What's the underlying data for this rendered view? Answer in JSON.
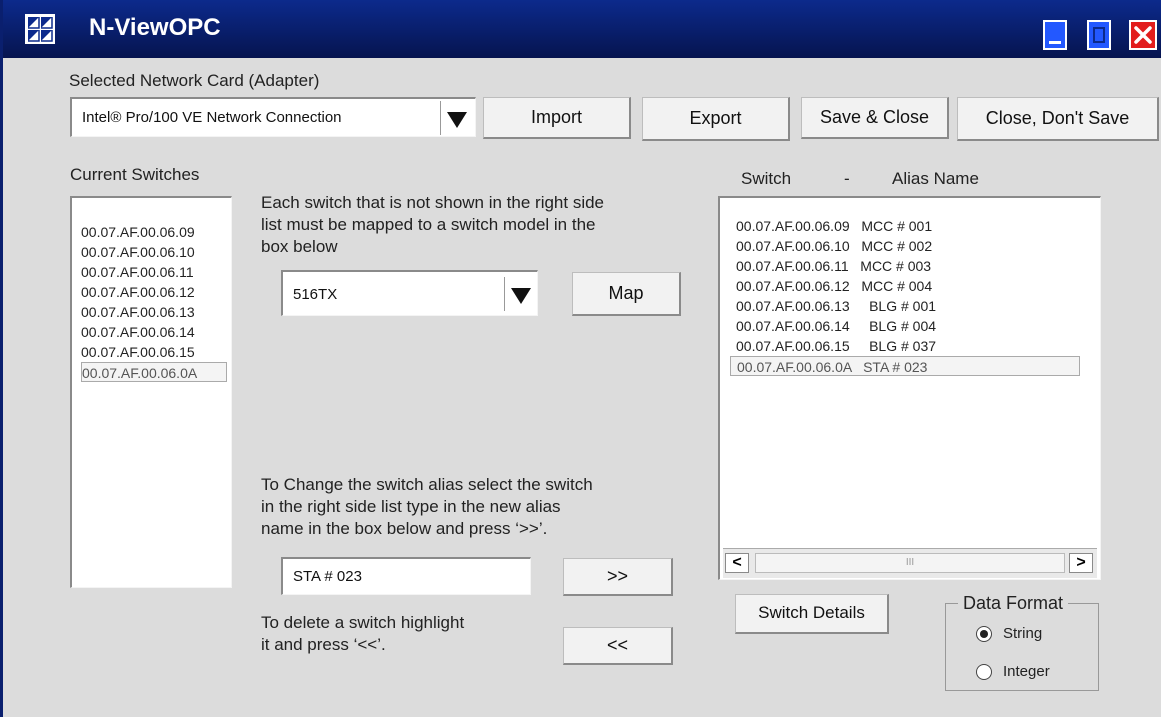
{
  "window": {
    "title": "N-ViewOPC"
  },
  "network": {
    "label": "Selected Network Card (Adapter)",
    "selected": "Intel® Pro/100 VE Network Connection"
  },
  "toolbar": {
    "import_label": "Import",
    "export_label": "Export",
    "save_close_label": "Save & Close",
    "close_nosave_label": "Close, Don't Save"
  },
  "current_switches": {
    "label": "Current Switches",
    "items": [
      "00.07.AF.00.06.09",
      "00.07.AF.00.06.10",
      "00.07.AF.00.06.11",
      "00.07.AF.00.06.12",
      "00.07.AF.00.06.13",
      "00.07.AF.00.06.14",
      "00.07.AF.00.06.15",
      "00.07.AF.00.06.0A"
    ]
  },
  "mapping": {
    "instructions": [
      "Each switch that is not shown in the right side",
      "list must be mapped to a switch model in the",
      "box below"
    ],
    "model_selected": "516TX",
    "map_label": "Map"
  },
  "alias": {
    "instructions": [
      "To Change the switch alias select the switch",
      "in the right side list type in the new alias",
      "name in the box below and press ‘>>’."
    ],
    "value": "STA # 023",
    "apply_label": ">>",
    "delete_instructions": [
      "To delete a switch highlight",
      "it and press ‘<<’."
    ],
    "delete_label": "<<"
  },
  "alias_list": {
    "header_switch": "Switch",
    "header_sep": "-",
    "header_alias": "Alias Name",
    "items": [
      "00.07.AF.00.06.09   MCC # 001",
      "00.07.AF.00.06.10   MCC # 002",
      "00.07.AF.00.06.11   MCC # 003",
      "00.07.AF.00.06.12   MCC # 004",
      "00.07.AF.00.06.13     BLG # 001",
      "00.07.AF.00.06.14     BLG # 004",
      "00.07.AF.00.06.15     BLG # 037",
      "00.07.AF.00.06.0A   STA # 023"
    ],
    "scroll_left": "<",
    "scroll_right": ">",
    "scroll_thumb": "III"
  },
  "details": {
    "label": "Switch Details"
  },
  "data_format": {
    "legend": "Data Format",
    "options": [
      "String",
      "Integer"
    ],
    "selected": "String"
  },
  "icons": {
    "logo": "app-logo-icon",
    "minimize": "minimize-icon",
    "maximize": "maximize-icon",
    "close": "close-icon",
    "dropdown": "chevron-down-icon"
  }
}
